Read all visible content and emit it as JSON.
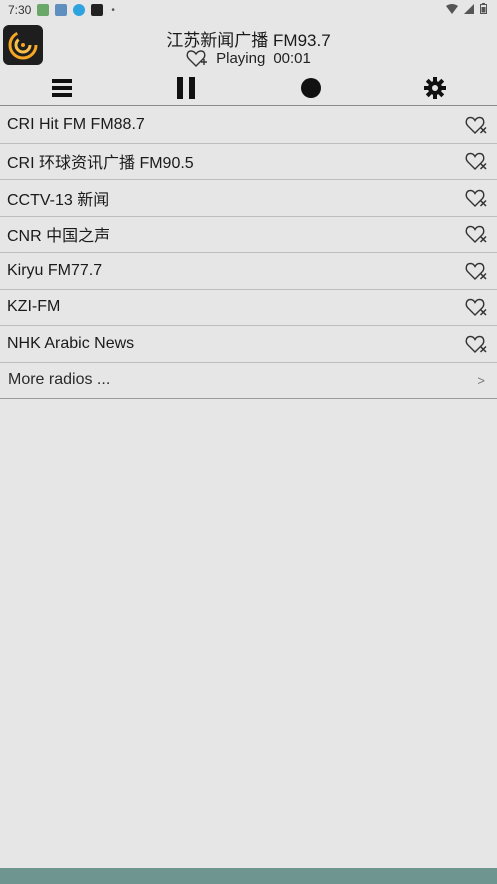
{
  "status_bar": {
    "time": "7:30",
    "dot": "•"
  },
  "header": {
    "station_title": "江苏新闻广播 FM93.7",
    "playing_label": "Playing",
    "play_time": "00:01"
  },
  "toolbar": {
    "icons": [
      "menu-icon",
      "pause-icon",
      "record-icon",
      "settings-icon"
    ]
  },
  "stations": [
    {
      "name": "CRI Hit FM FM88.7"
    },
    {
      "name": "CRI 环球资讯广播 FM90.5"
    },
    {
      "name": "CCTV-13 新闻"
    },
    {
      "name": "CNR 中国之声"
    },
    {
      "name": "Kiryu FM77.7"
    },
    {
      "name": "KZI-FM"
    },
    {
      "name": "NHK Arabic News"
    }
  ],
  "more": {
    "label": "More radios ...",
    "chevron": ">"
  },
  "colors": {
    "background": "#e6e6e6",
    "bottom_bar": "#6e958f",
    "logo_bg": "#1e1e1e",
    "logo_accent": "#f5a623"
  }
}
